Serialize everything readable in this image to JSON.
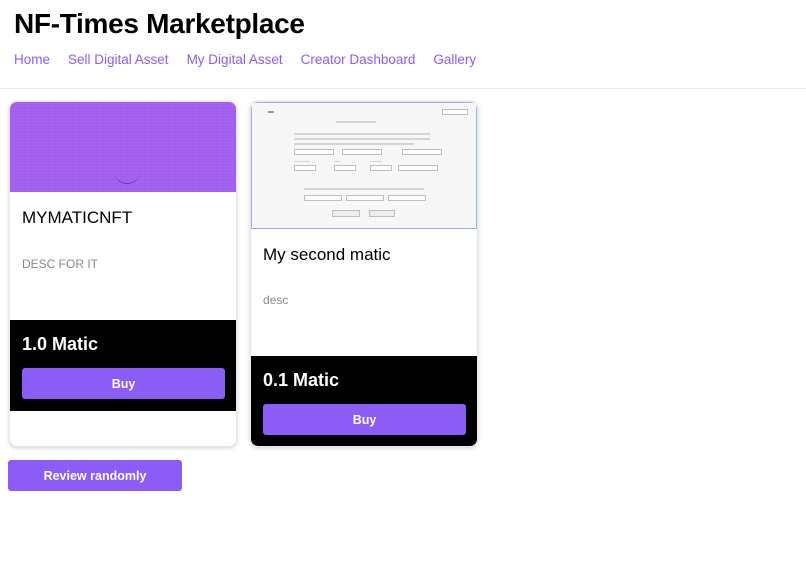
{
  "header": {
    "title": "NF-Times Marketplace",
    "nav": [
      "Home",
      "Sell Digital Asset",
      "My Digital Asset",
      "Creator Dashboard",
      "Gallery"
    ]
  },
  "cards": [
    {
      "name": "MYMATICNFT",
      "description": "DESC FOR IT",
      "price": "1.0 Matic",
      "buy_label": "Buy"
    },
    {
      "name": "My second matic",
      "description": "desc",
      "price": "0.1 Matic",
      "buy_label": "Buy"
    }
  ],
  "review_label": "Review randomly",
  "colors": {
    "accent": "#8b5cf6",
    "nft_purple": "#a15cf0",
    "price_panel": "#000000"
  }
}
